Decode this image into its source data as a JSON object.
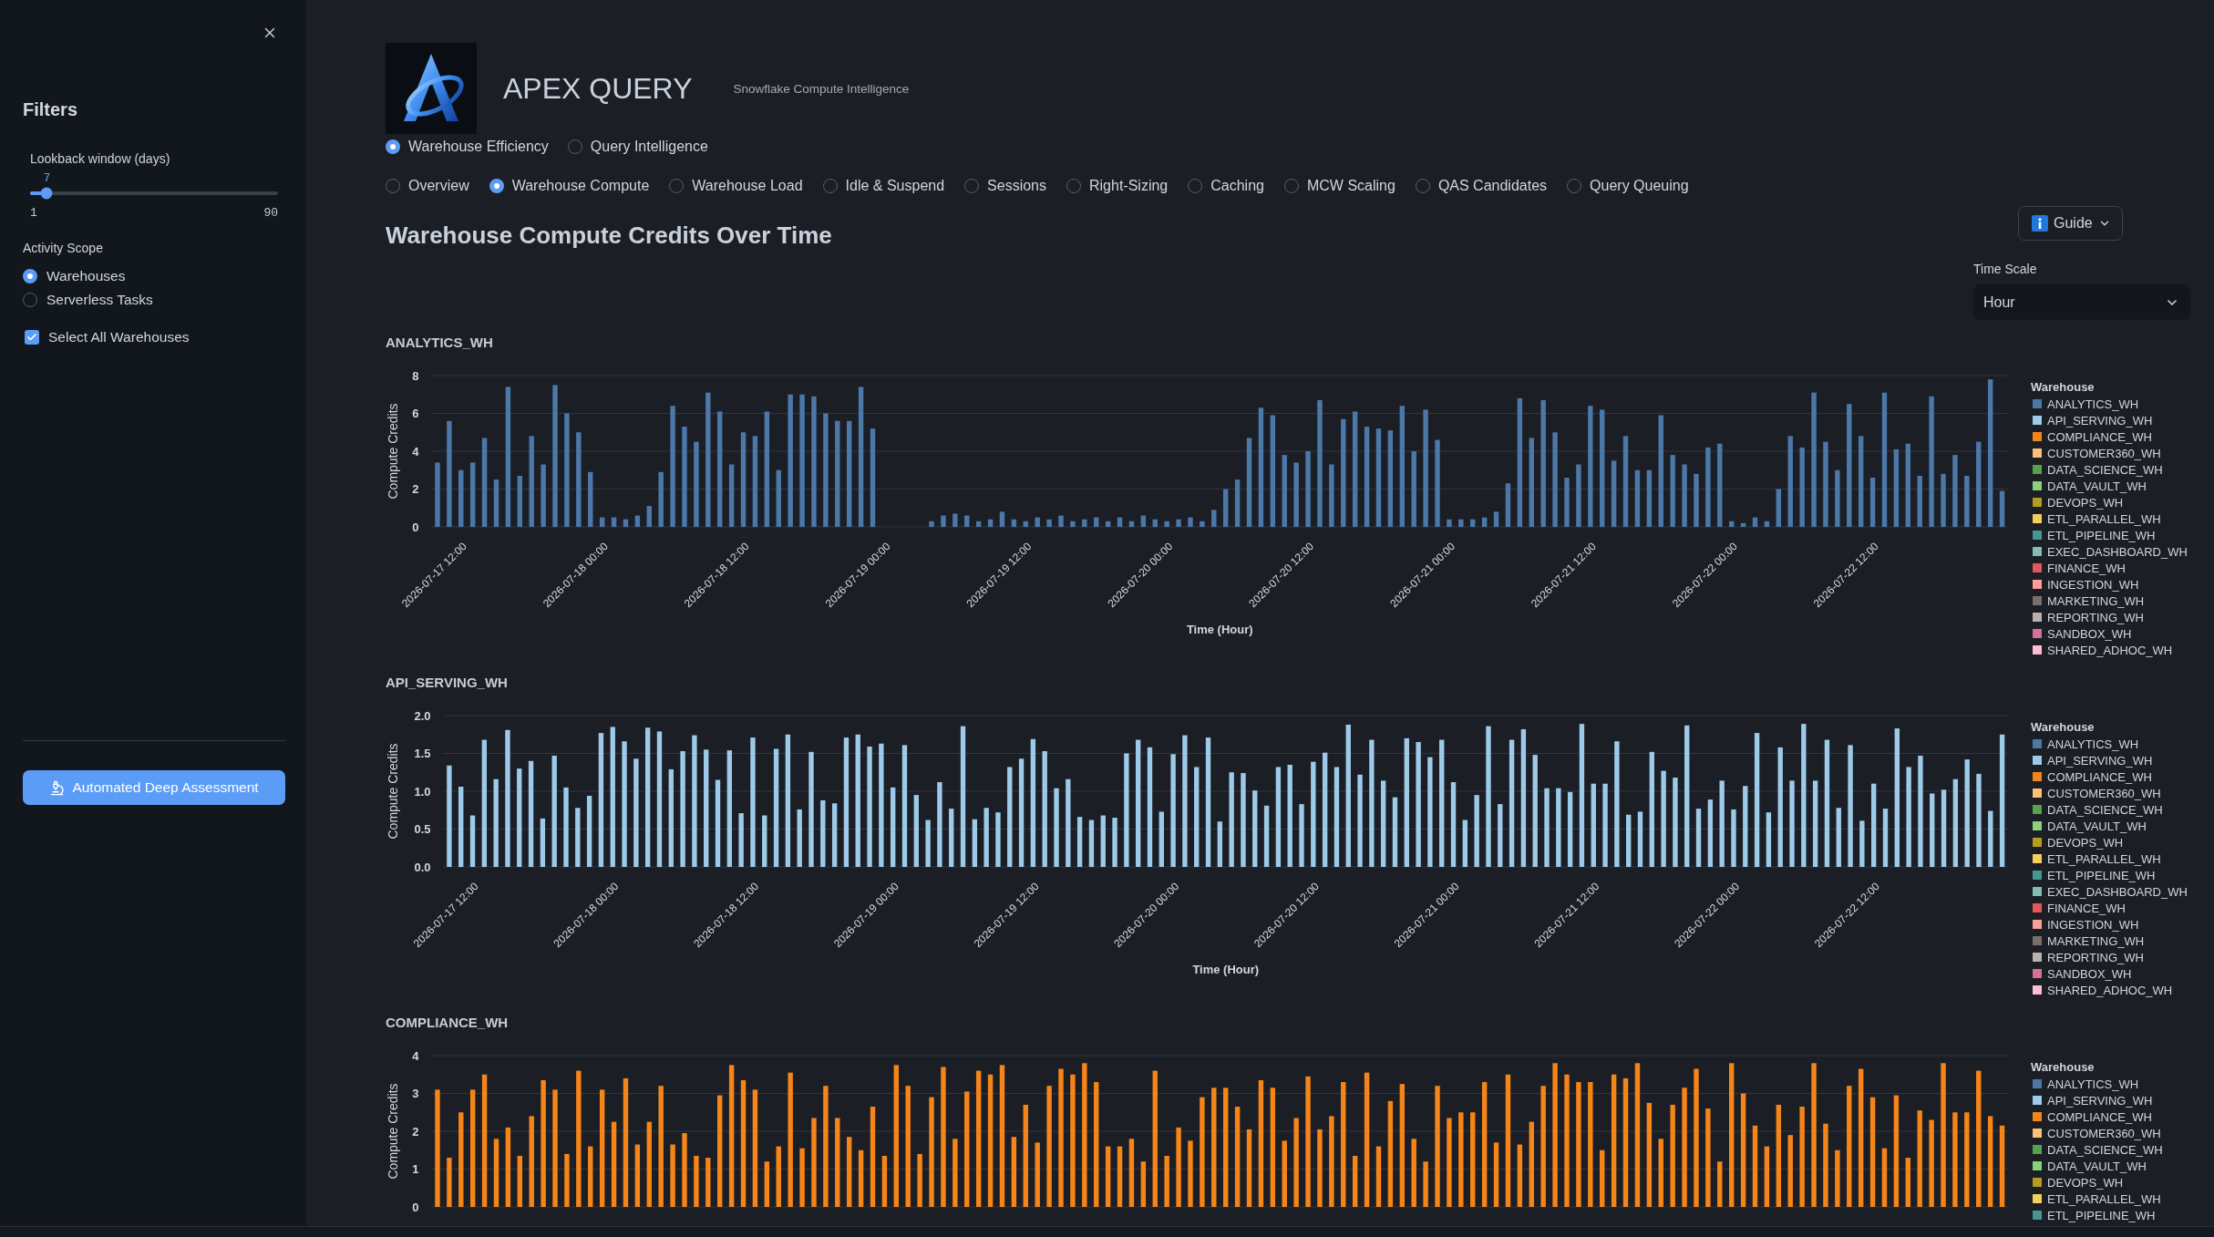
{
  "sidebar": {
    "title": "Filters",
    "lookback": {
      "label": "Lookback window (days)",
      "value": "7",
      "min": "1",
      "max": "90",
      "level": 0.0674
    },
    "activity_scope": {
      "label": "Activity Scope",
      "options": [
        {
          "label": "Warehouses",
          "selected": true
        },
        {
          "label": "Serverless Tasks",
          "selected": false
        }
      ]
    },
    "select_all": {
      "label": "Select All Warehouses",
      "checked": true
    },
    "assessment_button": {
      "label": "Automated Deep Assessment"
    }
  },
  "header": {
    "title": "APEX QUERY",
    "subtitle": "Snowflake Compute Intelligence"
  },
  "mode_options": [
    {
      "label": "Warehouse Efficiency",
      "selected": true
    },
    {
      "label": "Query Intelligence",
      "selected": false
    }
  ],
  "view_options": [
    {
      "label": "Overview",
      "selected": false
    },
    {
      "label": "Warehouse Compute",
      "selected": true
    },
    {
      "label": "Warehouse Load",
      "selected": false
    },
    {
      "label": "Idle & Suspend",
      "selected": false
    },
    {
      "label": "Sessions",
      "selected": false
    },
    {
      "label": "Right-Sizing",
      "selected": false
    },
    {
      "label": "Caching",
      "selected": false
    },
    {
      "label": "MCW Scaling",
      "selected": false
    },
    {
      "label": "QAS Candidates",
      "selected": false
    },
    {
      "label": "Query Queuing",
      "selected": false
    }
  ],
  "section_title": "Warehouse Compute Credits Over Time",
  "guide_button": {
    "label": "Guide"
  },
  "time_scale": {
    "label": "Time Scale",
    "value": "Hour"
  },
  "charts": [
    {
      "chart_data": {
        "type": "bar",
        "title": "ANALYTICS_WH",
        "xlabel": "Time (Hour)",
        "ylabel": "Compute Credits",
        "grid": true,
        "categories": [
          null,
          null,
          "2026-07-17 12:00",
          null,
          null,
          null,
          null,
          null,
          null,
          null,
          null,
          null,
          null,
          null,
          "2026-07-18 00:00",
          null,
          null,
          null,
          null,
          null,
          null,
          null,
          null,
          null,
          null,
          null,
          "2026-07-18 12:00",
          null,
          null,
          null,
          null,
          null,
          null,
          null,
          null,
          null,
          null,
          null,
          "2026-07-19 00:00",
          null,
          null,
          null,
          null,
          null,
          null,
          null,
          null,
          null,
          null,
          null,
          "2026-07-19 12:00",
          null,
          null,
          null,
          null,
          null,
          null,
          null,
          null,
          null,
          null,
          null,
          "2026-07-20 00:00",
          null,
          null,
          null,
          null,
          null,
          null,
          null,
          null,
          null,
          null,
          null,
          "2026-07-20 12:00",
          null,
          null,
          null,
          null,
          null,
          null,
          null,
          null,
          null,
          null,
          null,
          "2026-07-21 00:00",
          null,
          null,
          null,
          null,
          null,
          null,
          null,
          null,
          null,
          null,
          null,
          "2026-07-21 12:00",
          null,
          null,
          null,
          null,
          null,
          null,
          null,
          null,
          null,
          null,
          null,
          "2026-07-22 00:00",
          null,
          null,
          null,
          null,
          null,
          null,
          null,
          null,
          null,
          null,
          null,
          "2026-07-22 12:00",
          null,
          null,
          null,
          null,
          null,
          null,
          null,
          null,
          null,
          null,
          null
        ],
        "ylim": [
          0,
          8
        ],
        "yticks": [
          0,
          2,
          4,
          6,
          8
        ],
        "series": [
          {
            "color": "#4c78a8",
            "values": [
              3.4,
              5.6,
              3.0,
              3.4,
              4.7,
              2.5,
              7.4,
              2.7,
              4.8,
              3.3,
              7.5,
              6.0,
              5.0,
              2.9,
              0.5,
              0.5,
              0.4,
              0.6,
              1.1,
              2.9,
              6.4,
              5.3,
              4.5,
              7.1,
              6.1,
              3.3,
              5.0,
              4.8,
              6.1,
              3.0,
              7.0,
              7.0,
              6.9,
              6.0,
              5.6,
              5.6,
              7.4,
              5.2,
              0,
              0,
              0,
              0,
              0.3,
              0.6,
              0.7,
              0.6,
              0.3,
              0.4,
              0.8,
              0.4,
              0.3,
              0.5,
              0.4,
              0.6,
              0.3,
              0.4,
              0.5,
              0.3,
              0.5,
              0.3,
              0.6,
              0.4,
              0.3,
              0.4,
              0.5,
              0.3,
              0.9,
              2.0,
              2.5,
              4.7,
              6.3,
              5.9,
              3.8,
              3.4,
              4.0,
              6.7,
              3.3,
              5.7,
              6.1,
              5.3,
              5.2,
              5.1,
              6.4,
              4.0,
              6.2,
              4.6,
              0.4,
              0.4,
              0.4,
              0.5,
              0.8,
              2.3,
              6.8,
              4.7,
              6.7,
              5.0,
              2.6,
              3.3,
              6.4,
              6.2,
              3.5,
              4.8,
              3.0,
              3.0,
              5.9,
              3.8,
              3.3,
              2.8,
              4.2,
              4.4,
              0.3,
              0.2,
              0.5,
              0.3,
              2.0,
              4.8,
              4.2,
              7.1,
              4.5,
              3.0,
              6.5,
              4.8,
              2.6,
              7.1,
              4.1,
              4.4,
              2.7,
              6.9,
              2.8,
              3.8,
              2.7,
              4.5,
              7.8,
              1.9
            ]
          }
        ]
      },
      "legend": {
        "title": "Warehouse",
        "items": [
          {
            "name": "ANALYTICS_WH",
            "color": "#4c78a8"
          },
          {
            "name": "API_SERVING_WH",
            "color": "#9ecae9"
          },
          {
            "name": "COMPLIANCE_WH",
            "color": "#f58518"
          },
          {
            "name": "CUSTOMER360_WH",
            "color": "#ffbf79"
          },
          {
            "name": "DATA_SCIENCE_WH",
            "color": "#54a24b"
          },
          {
            "name": "DATA_VAULT_WH",
            "color": "#88d27a"
          },
          {
            "name": "DEVOPS_WH",
            "color": "#b79a20"
          },
          {
            "name": "ETL_PARALLEL_WH",
            "color": "#f2cf5b"
          },
          {
            "name": "ETL_PIPELINE_WH",
            "color": "#439894"
          },
          {
            "name": "EXEC_DASHBOARD_WH",
            "color": "#83bcb6"
          },
          {
            "name": "FINANCE_WH",
            "color": "#e45756"
          },
          {
            "name": "INGESTION_WH",
            "color": "#ff9d98"
          },
          {
            "name": "MARKETING_WH",
            "color": "#79706e"
          },
          {
            "name": "REPORTING_WH",
            "color": "#bab0ac"
          },
          {
            "name": "SANDBOX_WH",
            "color": "#d67195"
          },
          {
            "name": "SHARED_ADHOC_WH",
            "color": "#fcbfd2"
          }
        ]
      }
    },
    {
      "chart_data": {
        "type": "bar",
        "title": "API_SERVING_WH",
        "xlabel": "Time (Hour)",
        "ylabel": "Compute Credits",
        "grid": true,
        "categories": [
          null,
          null,
          "2026-07-17 12:00",
          null,
          null,
          null,
          null,
          null,
          null,
          null,
          null,
          null,
          null,
          null,
          "2026-07-18 00:00",
          null,
          null,
          null,
          null,
          null,
          null,
          null,
          null,
          null,
          null,
          null,
          "2026-07-18 12:00",
          null,
          null,
          null,
          null,
          null,
          null,
          null,
          null,
          null,
          null,
          null,
          "2026-07-19 00:00",
          null,
          null,
          null,
          null,
          null,
          null,
          null,
          null,
          null,
          null,
          null,
          "2026-07-19 12:00",
          null,
          null,
          null,
          null,
          null,
          null,
          null,
          null,
          null,
          null,
          null,
          "2026-07-20 00:00",
          null,
          null,
          null,
          null,
          null,
          null,
          null,
          null,
          null,
          null,
          null,
          "2026-07-20 12:00",
          null,
          null,
          null,
          null,
          null,
          null,
          null,
          null,
          null,
          null,
          null,
          "2026-07-21 00:00",
          null,
          null,
          null,
          null,
          null,
          null,
          null,
          null,
          null,
          null,
          null,
          "2026-07-21 12:00",
          null,
          null,
          null,
          null,
          null,
          null,
          null,
          null,
          null,
          null,
          null,
          "2026-07-22 00:00",
          null,
          null,
          null,
          null,
          null,
          null,
          null,
          null,
          null,
          null,
          null,
          "2026-07-22 12:00",
          null,
          null,
          null,
          null,
          null,
          null,
          null,
          null,
          null,
          null,
          null
        ],
        "ylim": [
          0,
          2
        ],
        "yticks": [
          {
            "value": 0,
            "label": "0.0"
          },
          {
            "value": 0.5,
            "label": "0.5"
          },
          {
            "value": 1,
            "label": "1.0"
          },
          {
            "value": 1.5,
            "label": "1.5"
          },
          {
            "value": 2,
            "label": "2.0"
          }
        ],
        "series": [
          {
            "color": "#9ecae9",
            "values": [
              1.34,
              1.06,
              0.68,
              1.68,
              1.16,
              1.81,
              1.3,
              1.4,
              0.64,
              1.47,
              1.05,
              0.78,
              0.94,
              1.77,
              1.85,
              1.66,
              1.43,
              1.84,
              1.79,
              1.29,
              1.53,
              1.74,
              1.55,
              1.15,
              1.54,
              0.71,
              1.71,
              0.68,
              1.56,
              1.75,
              0.76,
              1.52,
              0.88,
              0.84,
              1.71,
              1.75,
              1.59,
              1.63,
              1.05,
              1.61,
              0.95,
              0.62,
              1.12,
              0.77,
              1.86,
              0.63,
              0.78,
              0.72,
              1.32,
              1.43,
              1.69,
              1.53,
              1.04,
              1.16,
              0.66,
              0.62,
              0.68,
              0.65,
              1.5,
              1.68,
              1.58,
              0.73,
              1.49,
              1.74,
              1.32,
              1.71,
              0.6,
              1.25,
              1.24,
              1.01,
              0.81,
              1.32,
              1.35,
              0.83,
              1.39,
              1.51,
              1.32,
              1.88,
              1.22,
              1.68,
              1.14,
              0.92,
              1.7,
              1.65,
              1.45,
              1.68,
              1.12,
              0.62,
              0.95,
              1.86,
              0.83,
              1.68,
              1.82,
              1.48,
              1.04,
              1.04,
              0.99,
              1.89,
              1.1,
              1.1,
              1.66,
              0.69,
              0.73,
              1.52,
              1.27,
              1.18,
              1.87,
              0.77,
              0.89,
              1.14,
              0.76,
              1.07,
              1.77,
              0.72,
              1.58,
              1.14,
              1.89,
              1.14,
              1.68,
              0.78,
              1.61,
              0.61,
              1.1,
              0.77,
              1.83,
              1.32,
              1.47,
              0.97,
              1.02,
              1.16,
              1.42,
              1.23,
              0.74,
              1.75
            ]
          }
        ]
      },
      "legend": {
        "title": "Warehouse",
        "items": [
          {
            "name": "ANALYTICS_WH",
            "color": "#4c78a8"
          },
          {
            "name": "API_SERVING_WH",
            "color": "#9ecae9"
          },
          {
            "name": "COMPLIANCE_WH",
            "color": "#f58518"
          },
          {
            "name": "CUSTOMER360_WH",
            "color": "#ffbf79"
          },
          {
            "name": "DATA_SCIENCE_WH",
            "color": "#54a24b"
          },
          {
            "name": "DATA_VAULT_WH",
            "color": "#88d27a"
          },
          {
            "name": "DEVOPS_WH",
            "color": "#b79a20"
          },
          {
            "name": "ETL_PARALLEL_WH",
            "color": "#f2cf5b"
          },
          {
            "name": "ETL_PIPELINE_WH",
            "color": "#439894"
          },
          {
            "name": "EXEC_DASHBOARD_WH",
            "color": "#83bcb6"
          },
          {
            "name": "FINANCE_WH",
            "color": "#e45756"
          },
          {
            "name": "INGESTION_WH",
            "color": "#ff9d98"
          },
          {
            "name": "MARKETING_WH",
            "color": "#79706e"
          },
          {
            "name": "REPORTING_WH",
            "color": "#bab0ac"
          },
          {
            "name": "SANDBOX_WH",
            "color": "#d67195"
          },
          {
            "name": "SHARED_ADHOC_WH",
            "color": "#fcbfd2"
          }
        ]
      }
    },
    {
      "chart_data": {
        "type": "bar",
        "title": "COMPLIANCE_WH",
        "ylabel": "Compute Credits",
        "grid": true,
        "categories": [
          null,
          null,
          null,
          null,
          null,
          null,
          null,
          null,
          null,
          null,
          null,
          null,
          null,
          null,
          null,
          null,
          null,
          null,
          null,
          null,
          null,
          null,
          null,
          null,
          null,
          null,
          null,
          null,
          null,
          null,
          null,
          null,
          null,
          null,
          null,
          null,
          null,
          null,
          null,
          null,
          null,
          null,
          null,
          null,
          null,
          null,
          null,
          null,
          null,
          null,
          null,
          null,
          null,
          null,
          null,
          null,
          null,
          null,
          null,
          null,
          null,
          null,
          null,
          null,
          null,
          null,
          null,
          null,
          null,
          null,
          null,
          null,
          null,
          null,
          null,
          null,
          null,
          null,
          null,
          null,
          null,
          null,
          null,
          null,
          null,
          null,
          null,
          null,
          null,
          null,
          null,
          null,
          null,
          null,
          null,
          null,
          null,
          null,
          null,
          null,
          null,
          null,
          null,
          null,
          null,
          null,
          null,
          null,
          null,
          null,
          null,
          null,
          null,
          null,
          null,
          null,
          null,
          null,
          null,
          null,
          null,
          null,
          null,
          null,
          null,
          null,
          null,
          null,
          null,
          null,
          null,
          null,
          null,
          null
        ],
        "ylim": [
          0,
          4
        ],
        "yticks": [
          0,
          1,
          2,
          3,
          4
        ],
        "series": [
          {
            "color": "#f58518",
            "values": [
              3.1,
              1.3,
              2.5,
              3.1,
              3.5,
              1.8,
              2.1,
              1.35,
              2.4,
              3.35,
              3.1,
              1.4,
              3.6,
              1.6,
              3.1,
              2.25,
              3.4,
              1.65,
              2.25,
              3.2,
              1.65,
              1.95,
              1.35,
              1.3,
              2.95,
              3.75,
              3.35,
              3.1,
              1.2,
              1.6,
              3.55,
              1.55,
              2.35,
              3.2,
              2.35,
              1.85,
              1.5,
              2.65,
              1.35,
              3.75,
              3.2,
              1.4,
              2.9,
              3.7,
              1.8,
              3.05,
              3.6,
              3.5,
              3.75,
              1.85,
              2.7,
              1.7,
              3.2,
              3.65,
              3.5,
              3.8,
              3.3,
              1.6,
              1.6,
              1.8,
              1.2,
              3.6,
              1.35,
              2.1,
              1.75,
              2.9,
              3.15,
              3.15,
              2.65,
              2.05,
              3.35,
              3.15,
              1.75,
              2.35,
              3.45,
              2.05,
              2.4,
              3.3,
              1.35,
              3.55,
              1.6,
              2.8,
              3.25,
              1.8,
              1.2,
              3.2,
              2.35,
              2.5,
              2.5,
              3.3,
              1.7,
              3.5,
              1.65,
              2.25,
              3.2,
              3.8,
              3.5,
              3.3,
              3.3,
              1.5,
              3.5,
              3.4,
              3.8,
              2.75,
              1.8,
              2.7,
              3.15,
              3.65,
              2.6,
              1.2,
              3.8,
              3.0,
              2.15,
              1.6,
              2.7,
              1.9,
              2.65,
              3.8,
              2.2,
              1.5,
              3.2,
              3.65,
              2.9,
              1.55,
              2.95,
              1.3,
              2.55,
              2.3,
              3.8,
              2.5,
              2.5,
              3.6,
              2.4,
              2.15
            ]
          }
        ]
      },
      "legend": {
        "title": "Warehouse",
        "items": [
          {
            "name": "ANALYTICS_WH",
            "color": "#4c78a8"
          },
          {
            "name": "API_SERVING_WH",
            "color": "#9ecae9"
          },
          {
            "name": "COMPLIANCE_WH",
            "color": "#f58518"
          },
          {
            "name": "CUSTOMER360_WH",
            "color": "#ffbf79"
          },
          {
            "name": "DATA_SCIENCE_WH",
            "color": "#54a24b"
          },
          {
            "name": "DATA_VAULT_WH",
            "color": "#88d27a"
          },
          {
            "name": "DEVOPS_WH",
            "color": "#b79a20"
          },
          {
            "name": "ETL_PARALLEL_WH",
            "color": "#f2cf5b"
          },
          {
            "name": "ETL_PIPELINE_WH",
            "color": "#439894"
          }
        ]
      }
    }
  ]
}
